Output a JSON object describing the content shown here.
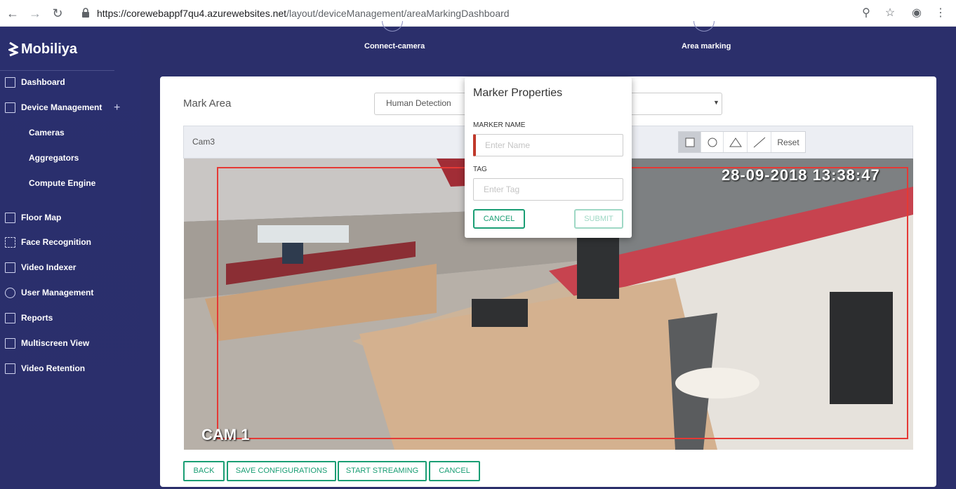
{
  "browser": {
    "url_host": "https://corewebappf7qu4.azurewebsites.net",
    "url_path": "/layout/deviceManagement/areaMarkingDashboard"
  },
  "brand": {
    "name": "Mobiliya"
  },
  "sidebar": {
    "items": [
      {
        "label": "Dashboard",
        "icon": "grid-icon"
      },
      {
        "label": "Device Management",
        "icon": "list-icon"
      },
      {
        "label": "Cameras"
      },
      {
        "label": "Aggregators"
      },
      {
        "label": "Compute Engine"
      },
      {
        "label": "Floor Map",
        "icon": "map-icon"
      },
      {
        "label": "Face Recognition",
        "icon": "face-scan-icon"
      },
      {
        "label": "Video Indexer",
        "icon": "film-icon"
      },
      {
        "label": "User Management",
        "icon": "user-icon"
      },
      {
        "label": "Reports",
        "icon": "chart-icon"
      },
      {
        "label": "Multiscreen View",
        "icon": "grid-icon"
      },
      {
        "label": "Video Retention",
        "icon": "film-icon"
      }
    ],
    "expand_symbol": "+"
  },
  "stepper": {
    "steps": [
      "Connect-camera",
      "Area marking"
    ]
  },
  "main": {
    "title": "Mark Area",
    "detection_select": "Human Detection",
    "camera_name": "Cam3",
    "tools": {
      "reset_label": "Reset"
    },
    "video": {
      "timestamp": "28-09-2018 13:38:47",
      "overlay_label": "CAM 1"
    },
    "buttons": {
      "back": "BACK",
      "save": "SAVE CONFIGURATIONS",
      "start": "START STREAMING",
      "cancel": "CANCEL"
    }
  },
  "modal": {
    "title": "Marker Properties",
    "name_label": "MARKER NAME",
    "name_placeholder": "Enter Name",
    "tag_label": "TAG",
    "tag_placeholder": "Enter Tag",
    "cancel_label": "CANCEL",
    "submit_label": "SUBMIT"
  },
  "colors": {
    "accent": "#1a9e74",
    "sidebar": "#2b2f6b",
    "roi": "#e53935",
    "error": "#c0392b"
  }
}
